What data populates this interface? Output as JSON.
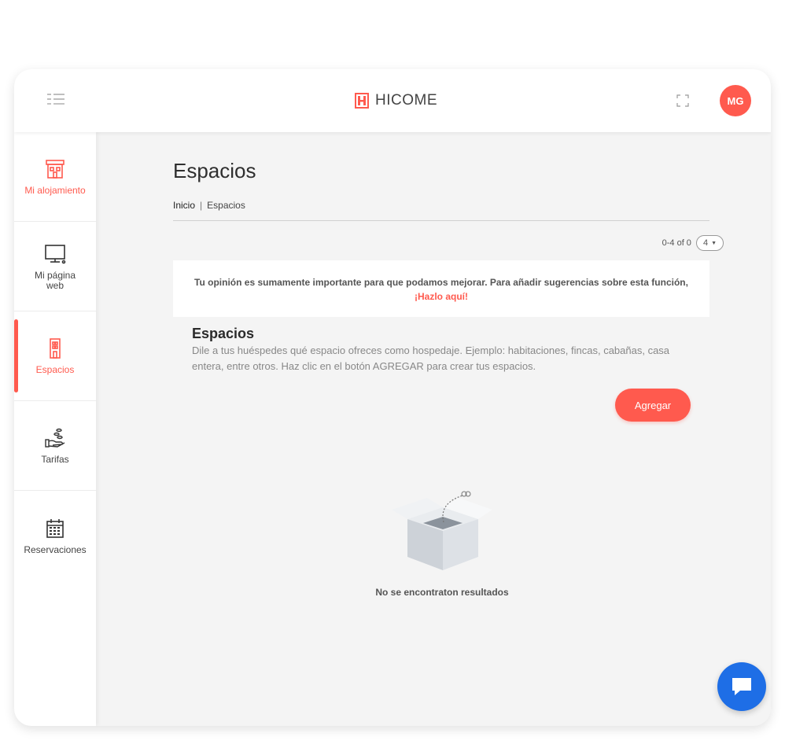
{
  "header": {
    "logo_text": "HICOME",
    "avatar_initials": "MG",
    "brand_color": "#ff5a4e"
  },
  "sidebar": {
    "items": [
      {
        "label": "Mi alojamiento",
        "icon": "building-icon"
      },
      {
        "label": "Mi página web",
        "icon": "monitor-icon"
      },
      {
        "label": "Espacios",
        "icon": "door-icon"
      },
      {
        "label": "Tarifas",
        "icon": "hand-coins-icon"
      },
      {
        "label": "Reservaciones",
        "icon": "calendar-icon"
      }
    ]
  },
  "main": {
    "title": "Espacios",
    "breadcrumb": {
      "home": "Inicio",
      "separator": "|",
      "current": "Espacios"
    },
    "pager": {
      "range_text": "0-4 of 0",
      "per_page": "4"
    },
    "feedback": {
      "text": "Tu opinión es sumamente importante para que podamos mejorar. Para añadir sugerencias sobre esta función,",
      "link": "¡Hazlo aquí!"
    },
    "section": {
      "title": "Espacios",
      "description": "Dile a tus huéspedes qué espacio ofreces como hospedaje. Ejemplo: habitaciones, fincas, cabañas, casa entera, entre otros. Haz clic en el botón AGREGAR para crear tus espacios."
    },
    "add_button": "Agregar",
    "empty_text": "No se encontraton resultados"
  },
  "chat": {
    "icon": "chat-icon",
    "color": "#1e6ee6"
  }
}
